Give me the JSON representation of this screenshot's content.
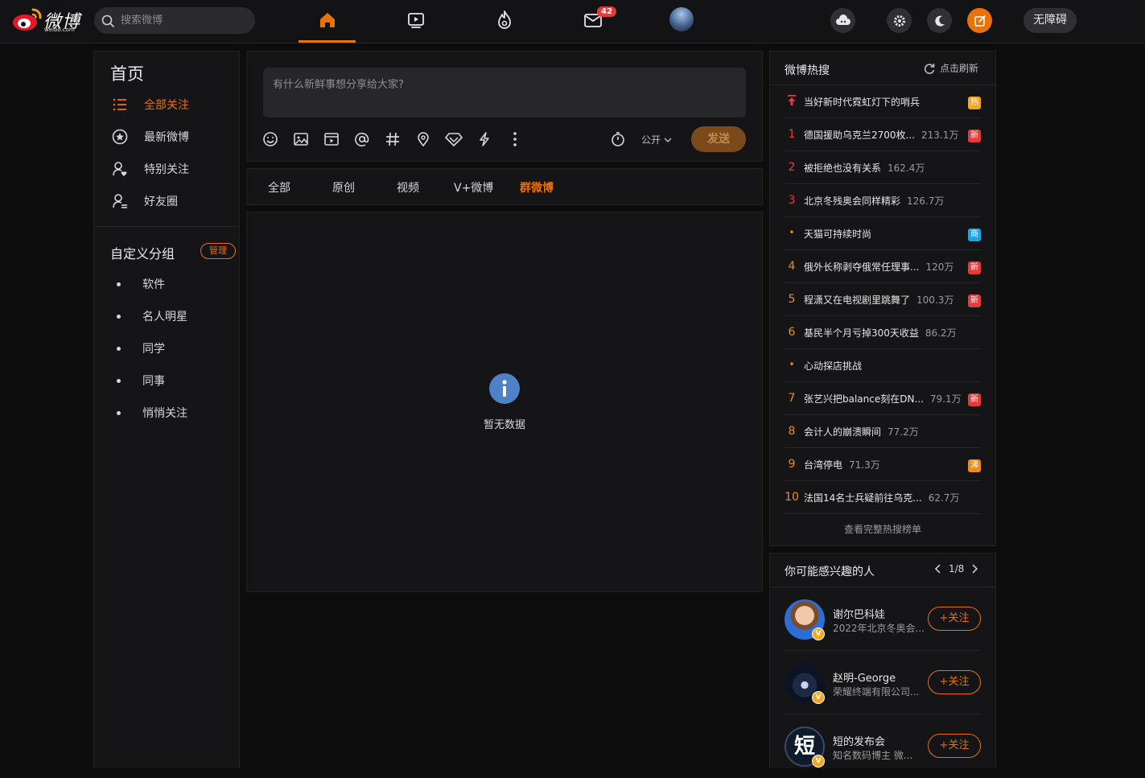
{
  "app": {
    "logo_text": "微博",
    "logo_sub": "weibo.com"
  },
  "search": {
    "placeholder": "搜索微博"
  },
  "nav": {
    "items": [
      {
        "name": "home-icon",
        "active": true
      },
      {
        "name": "video-icon"
      },
      {
        "name": "hot-icon"
      },
      {
        "name": "message-icon",
        "badge": "42"
      },
      {
        "name": "profile-avatar"
      }
    ]
  },
  "top_right": {
    "accessibility_label": "无障碍"
  },
  "colors": {
    "accent": "#e8710a",
    "badge_red": "#e6393a"
  },
  "left": {
    "title": "首页",
    "items": [
      {
        "label": "全部关注",
        "icon": "list-icon",
        "active": true
      },
      {
        "label": "最新微博",
        "icon": "star-circle-icon"
      },
      {
        "label": "特别关注",
        "icon": "user-heart-icon"
      },
      {
        "label": "好友圈",
        "icon": "friends-icon"
      }
    ],
    "groups_title": "自定义分组",
    "manage_label": "管理",
    "groups": [
      "软件",
      "名人明星",
      "同学",
      "同事",
      "悄悄关注"
    ]
  },
  "compose": {
    "placeholder": "有什么新鲜事想分享给大家?",
    "visibility": "公开",
    "send_label": "发送"
  },
  "tabs": [
    "全部",
    "原创",
    "视频",
    "V+微博",
    "群微博"
  ],
  "active_tab": "群微博",
  "feed": {
    "empty_text": "暂无数据"
  },
  "hot": {
    "title": "微博热搜",
    "refresh_label": "点击刷新",
    "items": [
      {
        "rank": "",
        "title": "当好新时代霓虹灯下的哨兵",
        "count": "",
        "tag": "热",
        "tag_color": "#f5a623",
        "pinned": true
      },
      {
        "rank": "1",
        "title": "德国援助乌克兰2700枚...",
        "count": "213.1万",
        "tag": "新",
        "tag_color": "#e6393a"
      },
      {
        "rank": "2",
        "title": "被拒绝也没有关系",
        "count": "162.4万",
        "tag": "",
        "tag_color": ""
      },
      {
        "rank": "3",
        "title": "北京冬残奥会同样精彩",
        "count": "126.7万",
        "tag": "",
        "tag_color": ""
      },
      {
        "rank": "•",
        "title": "天猫可持续时尚",
        "count": "",
        "tag": "商",
        "tag_color": "#1ba5e8"
      },
      {
        "rank": "4",
        "title": "俄外长称剥夺俄常任理事...",
        "count": "120万",
        "tag": "新",
        "tag_color": "#e6393a"
      },
      {
        "rank": "5",
        "title": "程潇又在电视剧里跳舞了",
        "count": "100.3万",
        "tag": "新",
        "tag_color": "#e6393a"
      },
      {
        "rank": "6",
        "title": "基民半个月亏掉300天收益",
        "count": "86.2万",
        "tag": "",
        "tag_color": ""
      },
      {
        "rank": "•",
        "title": "心动探店挑战",
        "count": "",
        "tag": "",
        "tag_color": ""
      },
      {
        "rank": "7",
        "title": "张艺兴把balance刻在DN...",
        "count": "79.1万",
        "tag": "新",
        "tag_color": "#e6393a"
      },
      {
        "rank": "8",
        "title": "会计人的崩溃瞬间",
        "count": "77.2万",
        "tag": "",
        "tag_color": ""
      },
      {
        "rank": "9",
        "title": "台湾停电",
        "count": "71.3万",
        "tag": "沸",
        "tag_color": "#f08c1a"
      },
      {
        "rank": "10",
        "title": "法国14名士兵疑前往乌克...",
        "count": "62.7万",
        "tag": "",
        "tag_color": ""
      }
    ],
    "more_label": "查看完整热搜榜单"
  },
  "people": {
    "title": "你可能感兴趣的人",
    "page": "1/8",
    "follow_label": "+关注",
    "items": [
      {
        "name": "谢尔巴科娃",
        "desc": "2022年北京冬奥会...",
        "avatar_text": ""
      },
      {
        "name": "赵明-George",
        "desc": "荣耀终端有限公司...",
        "avatar_text": ""
      },
      {
        "name": "短的发布会",
        "desc": "知名数码博主 微...",
        "avatar_text": "短"
      }
    ]
  }
}
